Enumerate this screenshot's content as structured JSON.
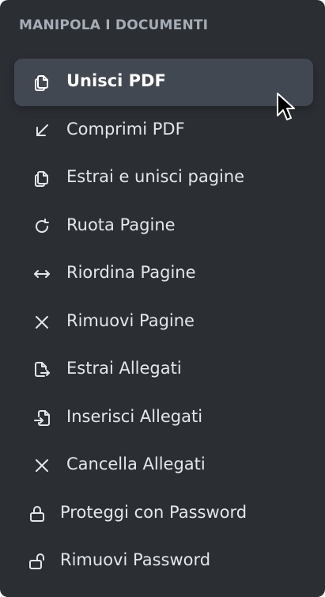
{
  "section": {
    "title": "MANIPOLA I DOCUMENTI"
  },
  "items": [
    {
      "label": "Unisci PDF",
      "icon": "merge-pdf-icon",
      "active": true
    },
    {
      "label": "Comprimi PDF",
      "icon": "compress-arrow-icon",
      "active": false
    },
    {
      "label": "Estrai e unisci pagine",
      "icon": "extract-merge-pages-icon",
      "active": false
    },
    {
      "label": "Ruota Pagine",
      "icon": "rotate-icon",
      "active": false
    },
    {
      "label": "Riordina Pagine",
      "icon": "reorder-arrows-icon",
      "active": false
    },
    {
      "label": "Rimuovi Pagine",
      "icon": "remove-x-icon",
      "active": false
    },
    {
      "label": "Estrai Allegati",
      "icon": "file-export-icon",
      "active": false
    },
    {
      "label": "Inserisci Allegati",
      "icon": "file-import-icon",
      "active": false
    },
    {
      "label": "Cancella Allegati",
      "icon": "delete-x-icon",
      "active": false
    },
    {
      "label": "Proteggi con Password",
      "icon": "lock-icon",
      "active": false
    },
    {
      "label": "Rimuovi Password",
      "icon": "unlock-icon",
      "active": false
    }
  ],
  "colors": {
    "panel_bg": "#2b2f34",
    "active_bg": "#424851",
    "text": "#e3e6ea",
    "section_title": "#a7adb5"
  }
}
